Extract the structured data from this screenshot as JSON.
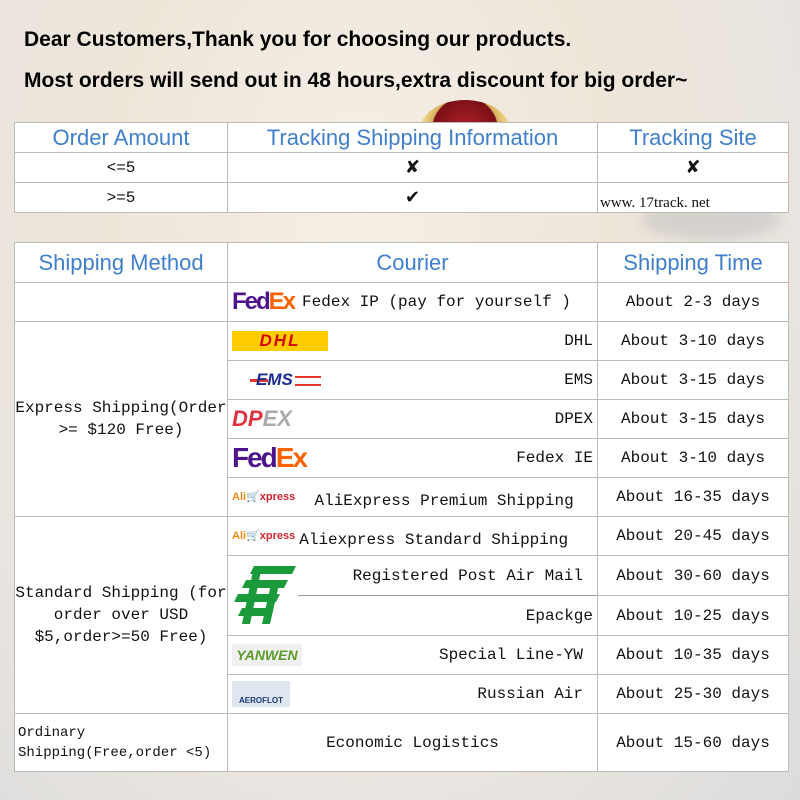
{
  "headline": {
    "line1": "Dear Customers,Thank you for choosing our products.",
    "line2": "Most orders will send out in 48 hours,extra discount for big order~"
  },
  "tracking_table": {
    "headers": [
      "Order Amount",
      "Tracking Shipping Information",
      "Tracking  Site"
    ],
    "rows": [
      {
        "amount": "<=5",
        "tracking": "✘",
        "site": "✘"
      },
      {
        "amount": ">=5",
        "tracking": "✔",
        "site": "www. 17track. net"
      }
    ]
  },
  "shipping_table": {
    "headers": [
      "Shipping Method",
      "Courier",
      "Shipping Time"
    ],
    "methods": {
      "express": "Express Shipping(Order >= $120 Free)",
      "standard": "Standard Shipping (for order over USD $5,order>=50 Free)",
      "ordinary": "Ordinary Shipping(Free,order <5)"
    },
    "rows": [
      {
        "logo": "fedex-logo",
        "courier": "Fedex IP (pay for yourself )",
        "time": "About 2-3 days"
      },
      {
        "logo": "dhl-logo",
        "logo_text": "DHL",
        "courier": "DHL",
        "time": "About 3-10 days"
      },
      {
        "logo": "ems-logo",
        "logo_text": "EMS",
        "courier": "EMS",
        "time": "About 3-15 days"
      },
      {
        "logo": "dpex-logo",
        "courier": "DPEX",
        "time": "About 3-15 days"
      },
      {
        "logo": "fedex-logo",
        "courier": "Fedex IE",
        "time": "About 3-10 days"
      },
      {
        "logo": "aliexpress-logo",
        "courier": "AliExpress Premium Shipping",
        "time": "About 16-35 days"
      },
      {
        "logo": "aliexpress-logo",
        "courier": "Aliexpress Standard Shipping",
        "time": "About 20-45 days"
      },
      {
        "logo": "china-post-logo",
        "courier": "Registered Post Air Mail",
        "time": "About 30-60 days"
      },
      {
        "courier": "Epackge",
        "time": "About 10-25 days"
      },
      {
        "logo": "yanwen-logo",
        "logo_text": "YANWEN",
        "courier": "Special Line-YW",
        "time": "About 10-35 days"
      },
      {
        "logo": "aeroflot-logo",
        "logo_text": "AEROFLOT",
        "courier": "Russian Air",
        "time": "About 25-30 days"
      },
      {
        "courier": "Economic Logistics",
        "time": "About 15-60 days"
      }
    ]
  },
  "colors": {
    "header_text": "#3f7fcb",
    "fedex_purple": "#4d148c",
    "fedex_orange": "#ff6200",
    "dhl_yellow": "#ffcc00",
    "dhl_red": "#d40511",
    "china_post_green": "#1a9a3a"
  }
}
